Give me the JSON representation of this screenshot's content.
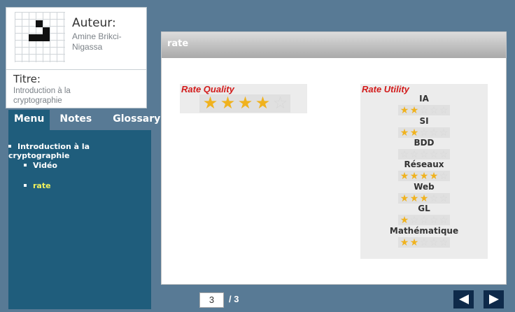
{
  "author": {
    "label": "Auteur:",
    "name": "Amine Brikci-Nigassa"
  },
  "course": {
    "label": "Titre:",
    "title": "Introduction à la cryptographie"
  },
  "tabs": [
    {
      "label": "Menu"
    },
    {
      "label": "Notes"
    },
    {
      "label": "Glossary"
    }
  ],
  "menu": {
    "items": [
      {
        "label": "Introduction à la cryptographie"
      },
      {
        "label": "Vidéo"
      },
      {
        "label": "rate"
      }
    ],
    "current": "rate"
  },
  "content": {
    "header": "rate",
    "quality": {
      "label": "Rate Quality",
      "rating": 4,
      "max": 5
    },
    "utility": {
      "label": "Rate Utility",
      "items": [
        {
          "name": "IA",
          "rating": 2
        },
        {
          "name": "SI",
          "rating": 2
        },
        {
          "name": "BDD",
          "rating": 0
        },
        {
          "name": "Réseaux",
          "rating": 4
        },
        {
          "name": "Web",
          "rating": 3
        },
        {
          "name": "GL",
          "rating": 1
        },
        {
          "name": "Mathématique",
          "rating": 2
        }
      ],
      "max": 5
    }
  },
  "pager": {
    "current": "3",
    "total": "/ 3"
  },
  "colors": {
    "accent": "#1f5d7c",
    "star_on": "#f0b21e",
    "highlight": "#f2f25b",
    "rate_label": "#d21a1a"
  },
  "icons": {
    "prev": "arrow-left-icon",
    "next": "arrow-right-icon",
    "star": "star-icon"
  }
}
